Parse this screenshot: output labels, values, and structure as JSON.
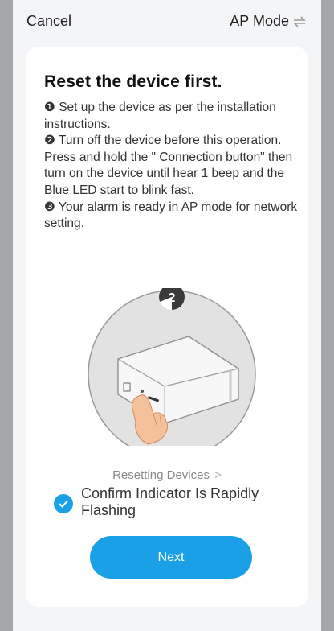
{
  "header": {
    "cancel_label": "Cancel",
    "mode_label": "AP Mode",
    "mode_icon": "swap-arrows-icon"
  },
  "card": {
    "title": "Reset the device first.",
    "steps": [
      "❶ Set up the device as per the installation instructions.",
      "❷ Turn off the device before this operation. Press and hold the \" Connection button\" then turn on the device until hear 1 beep and the Blue LED start to blink fast.",
      "❸ Your alarm is ready in AP mode for network setting."
    ],
    "illustration": {
      "step_badge": "2",
      "icon": "device-reset-illustration"
    },
    "resetting_link": "Resetting Devices",
    "confirm_label": "Confirm Indicator Is Rapidly Flashing",
    "confirm_checked": true,
    "next_label": "Next"
  },
  "colors": {
    "accent": "#1aa0e6",
    "page_bg": "#f4f5f7",
    "outer_bg": "#a3a7aa"
  }
}
